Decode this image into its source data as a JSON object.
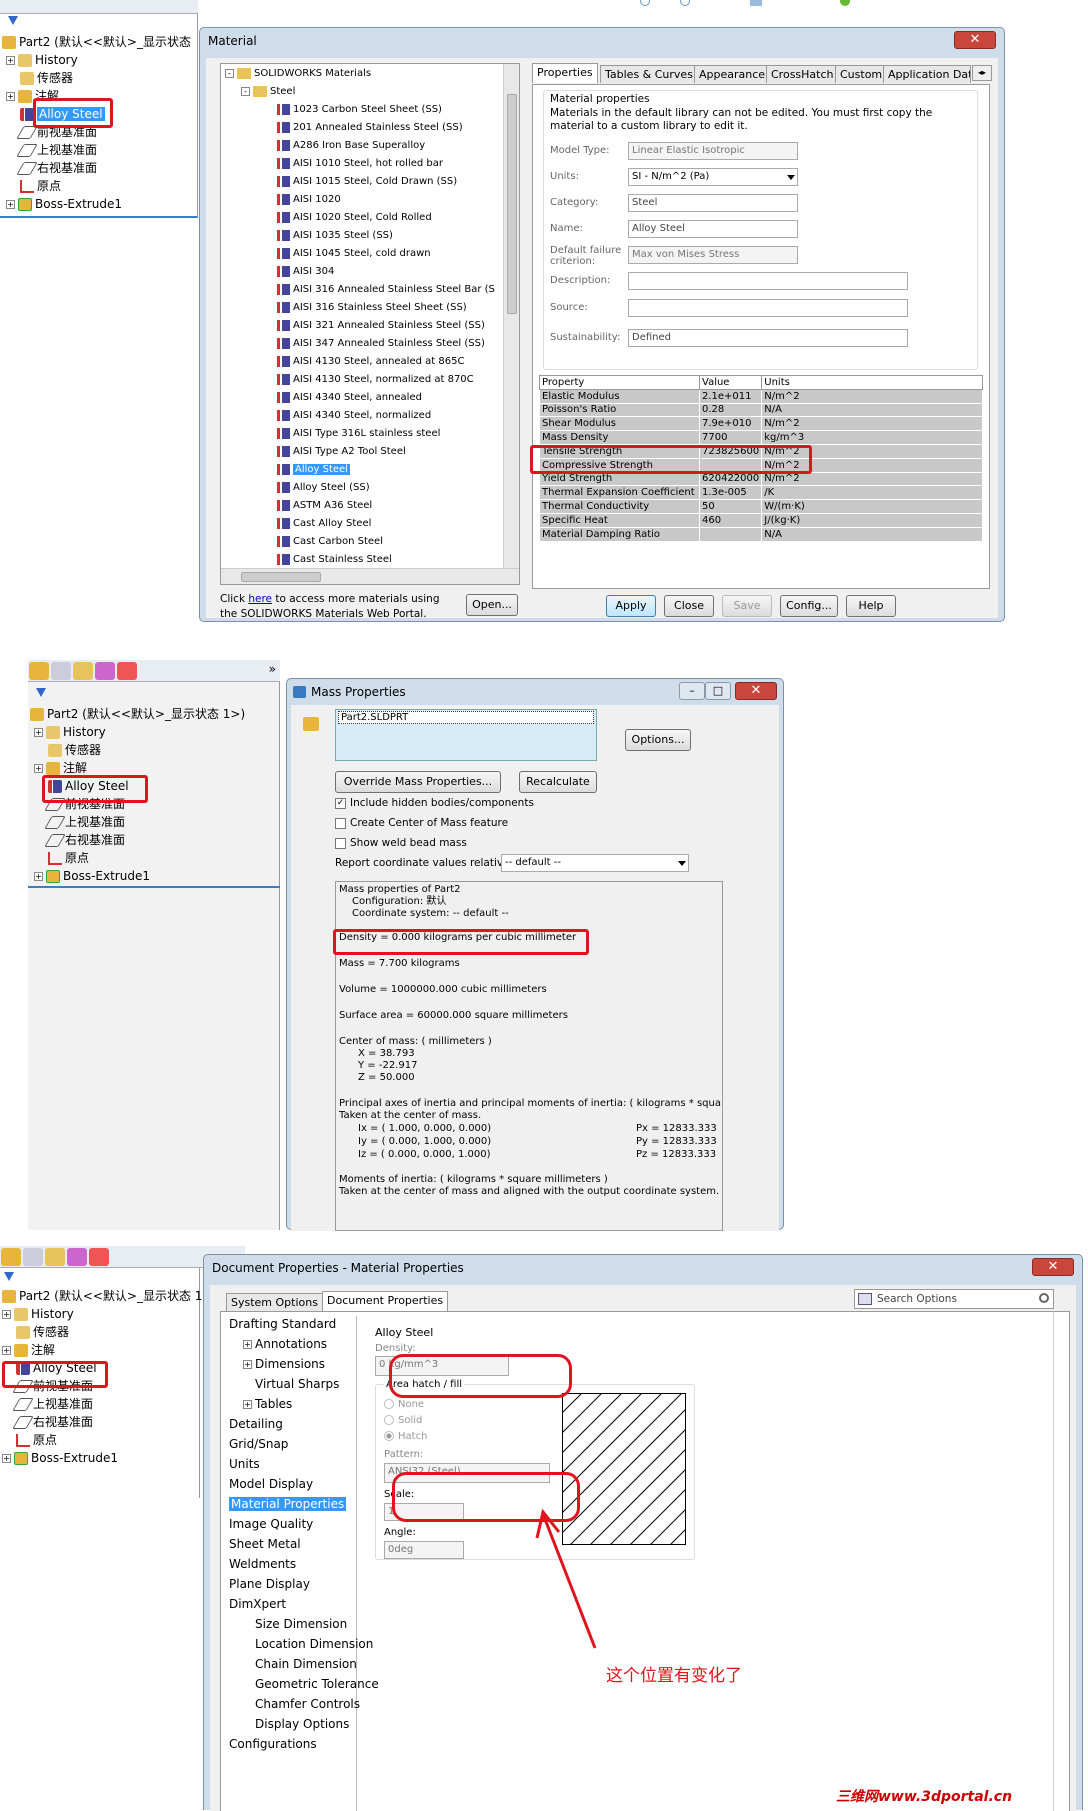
{
  "s1": {
    "tree": {
      "part": "Part2 (默认<<默认>_显示状态",
      "items": [
        "History",
        "传感器",
        "注解",
        "Alloy Steel",
        "前视基准面",
        "上视基准面",
        "右视基准面",
        "原点",
        "Boss-Extrude1"
      ]
    },
    "dialog_title": "Material",
    "close": "✕",
    "lib_root": "SOLIDWORKS Materials",
    "lib_folder": "Steel",
    "materials": [
      "1023 Carbon Steel Sheet (SS)",
      "201 Annealed Stainless Steel (SS)",
      "A286 Iron Base Superalloy",
      "AISI 1010 Steel, hot rolled bar",
      "AISI 1015 Steel, Cold Drawn (SS)",
      "AISI 1020",
      "AISI 1020 Steel, Cold Rolled",
      "AISI 1035 Steel (SS)",
      "AISI 1045 Steel, cold drawn",
      "AISI 304",
      "AISI 316 Annealed Stainless Steel Bar (S",
      "AISI 316 Stainless Steel Sheet (SS)",
      "AISI 321 Annealed Stainless Steel (SS)",
      "AISI 347 Annealed Stainless Steel (SS)",
      "AISI 4130 Steel, annealed at 865C",
      "AISI 4130 Steel, normalized at 870C",
      "AISI 4340 Steel, annealed",
      "AISI 4340 Steel, normalized",
      "AISI Type 316L stainless steel",
      "AISI Type A2 Tool Steel",
      "Alloy Steel",
      "Alloy Steel (SS)",
      "ASTM A36 Steel",
      "Cast Alloy Steel",
      "Cast Carbon Steel",
      "Cast Stainless Steel"
    ],
    "footer_a": "Click ",
    "footer_link": "here",
    "footer_b": " to access more materials using",
    "footer_c": "the SOLIDWORKS Materials Web Portal.",
    "open": "Open...",
    "tabs": [
      "Properties",
      "Tables & Curves",
      "Appearance",
      "CrossHatch",
      "Custom",
      "Application Dat"
    ],
    "group_title": "Material properties",
    "note": "Materials in the default library can not be edited. You must first copy the material to a custom library to edit it.",
    "lbl": {
      "model": "Model Type:",
      "units": "Units:",
      "cat": "Category:",
      "name": "Name:",
      "fail": "Default failure criterion:",
      "desc": "Description:",
      "src": "Source:",
      "sus": "Sustainability:"
    },
    "val": {
      "model": "Linear Elastic Isotropic",
      "units": "SI - N/m^2 (Pa)",
      "cat": "Steel",
      "name": "Alloy Steel",
      "fail": "Max von Mises Stress",
      "sus": "Defined"
    },
    "hdr": [
      "Property",
      "Value",
      "Units"
    ],
    "rows": [
      [
        "Elastic Modulus",
        "2.1e+011",
        "N/m^2"
      ],
      [
        "Poisson's Ratio",
        "0.28",
        "N/A"
      ],
      [
        "Shear Modulus",
        "7.9e+010",
        "N/m^2"
      ],
      [
        "Mass Density",
        "7700",
        "kg/m^3"
      ],
      [
        "Tensile Strength",
        "723825600",
        "N/m^2"
      ],
      [
        "Compressive Strength",
        "",
        "N/m^2"
      ],
      [
        "Yield Strength",
        "620422000",
        "N/m^2"
      ],
      [
        "Thermal Expansion Coefficient",
        "1.3e-005",
        "/K"
      ],
      [
        "Thermal Conductivity",
        "50",
        "W/(m·K)"
      ],
      [
        "Specific Heat",
        "460",
        "J/(kg·K)"
      ],
      [
        "Material Damping Ratio",
        "",
        "N/A"
      ]
    ],
    "btns": [
      "Apply",
      "Close",
      "Save",
      "Config...",
      "Help"
    ]
  },
  "s2": {
    "tree": {
      "part": "Part2 (默认<<默认>_显示状态 1>)",
      "items": [
        "History",
        "传感器",
        "注解",
        "Alloy Steel",
        "前视基准面",
        "上视基准面",
        "右视基准面",
        "原点",
        "Boss-Extrude1"
      ]
    },
    "title": "Mass Properties",
    "file": "Part2.SLDPRT",
    "options": "Options...",
    "override": "Override Mass Properties...",
    "recalc": "Recalculate",
    "chk1": "Include hidden bodies/components",
    "chk2": "Create Center of Mass feature",
    "chk3": "Show weld bead mass",
    "report_lbl": "Report coordinate values relative to:",
    "report_val": "-- default --",
    "out": {
      "l1": "Mass properties of Part2",
      "l2": "Configuration: 默认",
      "l3": "Coordinate system: -- default --",
      "density": "Density = 0.000 kilograms per cubic millimeter",
      "mass": "Mass = 7.700 kilograms",
      "volume": "Volume = 1000000.000 cubic millimeters",
      "area": "Surface area = 60000.000  square millimeters",
      "com": "Center of mass: ( millimeters )",
      "x": "X = 38.793",
      "y": "Y = -22.917",
      "z": "Z = 50.000",
      "pa": "Principal axes of inertia and principal moments of inertia: ( kilograms *  squa",
      "pa2": "Taken at the center of mass.",
      "ix": "Ix = ( 1.000,  0.000,  0.000)",
      "iy": "Iy = ( 0.000,  1.000,  0.000)",
      "iz": "Iz = ( 0.000,  0.000,  1.000)",
      "px": "Px = 12833.333",
      "py": "Py = 12833.333",
      "pz": "Pz = 12833.333",
      "mi": "Moments of inertia: ( kilograms *  square millimeters )",
      "mi2": "Taken at the center of mass and aligned with the output coordinate system."
    }
  },
  "s3": {
    "tree": {
      "part": "Part2 (默认<<默认>_显示状态 1>",
      "items": [
        "History",
        "传感器",
        "注解",
        "Alloy Steel",
        "前视基准面",
        "上视基准面",
        "右视基准面",
        "原点",
        "Boss-Extrude1"
      ]
    },
    "title": "Document Properties - Material Properties",
    "tabs": [
      "System Options",
      "Document Properties"
    ],
    "search": "Search Options",
    "nav": [
      "Drafting Standard",
      "Annotations",
      "Dimensions",
      "Virtual Sharps",
      "Tables",
      "Detailing",
      "Grid/Snap",
      "Units",
      "Model Display",
      "Material Properties",
      "Image Quality",
      "Sheet Metal",
      "Weldments",
      "Plane Display",
      "DimXpert",
      "Size Dimension",
      "Location Dimension",
      "Chain Dimension",
      "Geometric Tolerance",
      "Chamfer Controls",
      "Display Options",
      "Configurations"
    ],
    "mat": "Alloy Steel",
    "density_lbl": "Density:",
    "density": "0 kg/mm^3",
    "hatch_lbl": "Area hatch / fill",
    "r1": "None",
    "r2": "Solid",
    "r3": "Hatch",
    "pattern_lbl": "Pattern:",
    "pattern": "ANSI32 (Steel)",
    "scale_lbl": "Scale:",
    "scale": "1",
    "angle_lbl": "Angle:",
    "angle": "0deg",
    "annotation": "这个位置有变化了",
    "watermark": "三维网www.3dportal.cn"
  },
  "colors": {
    "red": "#e0141e",
    "select": "#3399ff",
    "brand_red": "#cc0000"
  }
}
